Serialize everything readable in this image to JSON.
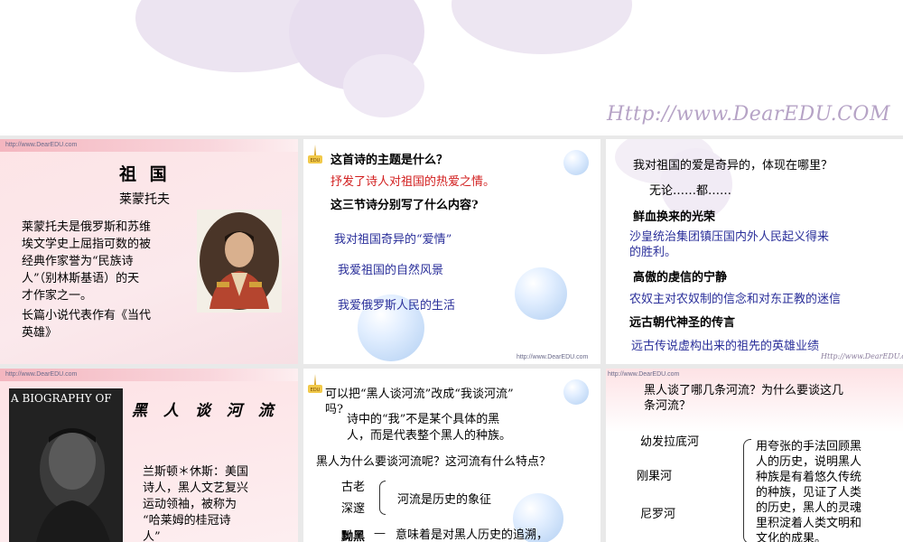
{
  "banner": {
    "url": "Http://www.DearEDU.COM",
    "blob_color": "#e9e1ef"
  },
  "colors": {
    "red": "#d21f1f",
    "blue": "#2a2f9a",
    "pink": "#fde4e6"
  },
  "slide1": {
    "site": "http://www.DearEDU.com",
    "title": "祖 国",
    "author": "莱蒙托夫",
    "intro": [
      "莱蒙托夫是俄罗斯和苏维",
      "埃文学史上屈指可数的被",
      "经典作家誉为“民族诗",
      "人”（别林斯基语）的天",
      "才作家之一。"
    ],
    "novel": [
      "长篇小说代表作有《当代",
      "英雄》"
    ]
  },
  "slide2": {
    "q1": "这首诗的主题是什么？",
    "a1": "抒发了诗人对祖国的热爱之情。",
    "q2": "这三节诗分别写了什么内容?",
    "items": [
      "我对祖国奇异的“爱情”",
      "我爱祖国的自然风景",
      "我爱俄罗斯人民的生活"
    ],
    "site": "http://www.DearEDU.com"
  },
  "slide3": {
    "q": "我对祖国的爱是奇异的，体现在哪里？",
    "l1": "无论……都……",
    "h1": "鲜血换来的光荣",
    "b1": [
      "沙皇统治集团镇压国内外人民起义得来",
      "的胜利。"
    ],
    "h2": "高傲的虔信的宁静",
    "b2": "农奴主对农奴制的信念和对东正教的迷信",
    "h3": "远古朝代神圣的传言",
    "b3": "远古传说虚构出来的祖先的英雄业绩",
    "site": "Http://www.DearEDU.com"
  },
  "slide4": {
    "site": "http://www.DearEDU.com",
    "book_title": "A BIOGRAPHY OF",
    "title": "黑 人 谈 河 流",
    "intro": [
      "兰斯顿＊休斯：美国",
      "诗人，黑人文艺复兴",
      "运动领袖，被称为",
      "“哈莱姆的桂冠诗",
      "人”"
    ]
  },
  "slide5": {
    "q1": [
      "可以把“黑人谈河流”改成“我谈河流”",
      "吗?"
    ],
    "a1": [
      "诗中的“我”不是某个具体的黑",
      "人，而是代表整个黑人的种族。"
    ],
    "q2": "黑人为什么要谈河流呢？这河流有什么特点？",
    "k1": "古老",
    "k2": "深邃",
    "v1": "河流是历史的象征",
    "k3": "黝黑",
    "v2": "意味着是对黑人历史的追溯，"
  },
  "slide6": {
    "site": "http://www.DearEDU.com",
    "q": [
      "黑人谈了哪几条河流？为什么要谈这几",
      "条河流？"
    ],
    "rivers": [
      "幼发拉底河",
      "刚果河",
      "尼罗河"
    ],
    "answer": [
      "用夸张的手法回顾黑",
      "人的历史，说明黑人",
      "种族是有着悠久传统",
      "的种族，见证了人类",
      "的历史，黑人的灵魂",
      "里积淀着人类文明和",
      "文化的成果。"
    ]
  }
}
